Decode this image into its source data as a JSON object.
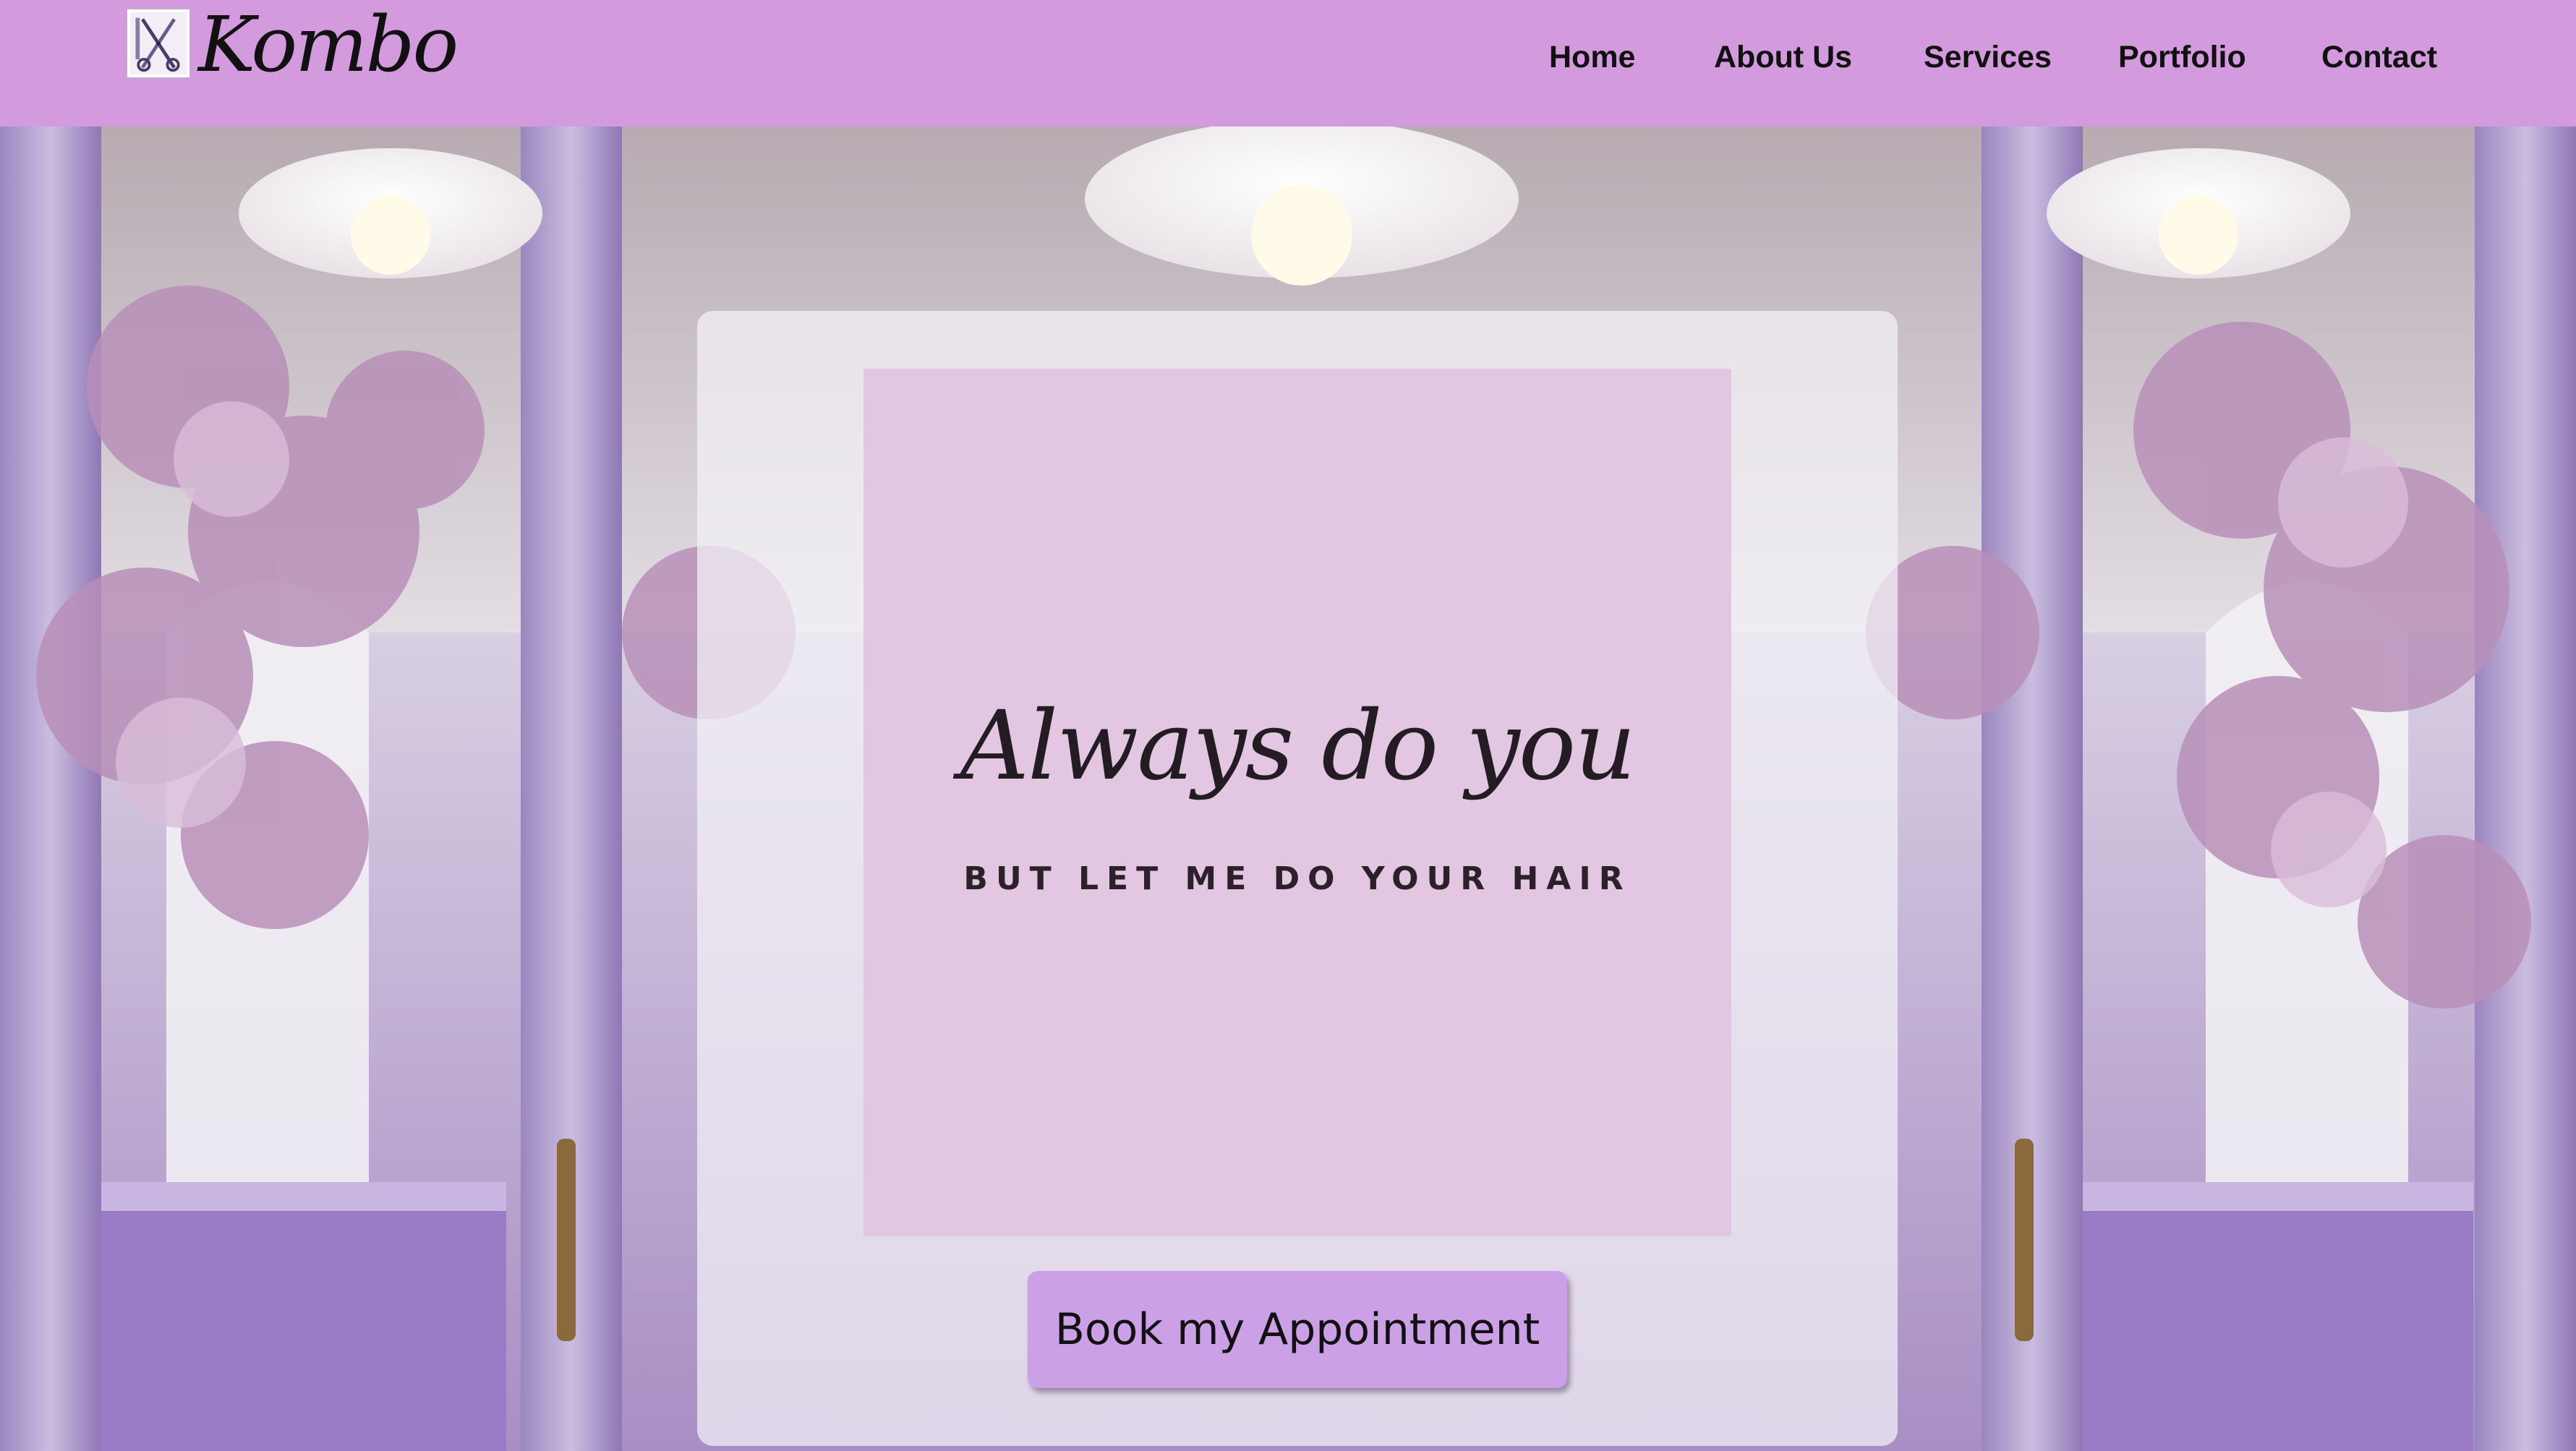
{
  "header": {
    "brand": "Kombo",
    "logo_icon": "scissors-comb-icon",
    "nav": [
      "Home",
      "About Us",
      "Services",
      "Portfolio",
      "Contact"
    ]
  },
  "hero": {
    "background": "salon-interior-image",
    "poster": {
      "tagline": "Always do you",
      "subline": "BUT LET ME DO YOUR HAIR"
    },
    "cta_label": "Book my Appointment"
  },
  "colors": {
    "header_bg": "#d49ade",
    "poster_bg": "#e2c6e2",
    "button_bg": "#cca0e6",
    "text": "#111111"
  }
}
